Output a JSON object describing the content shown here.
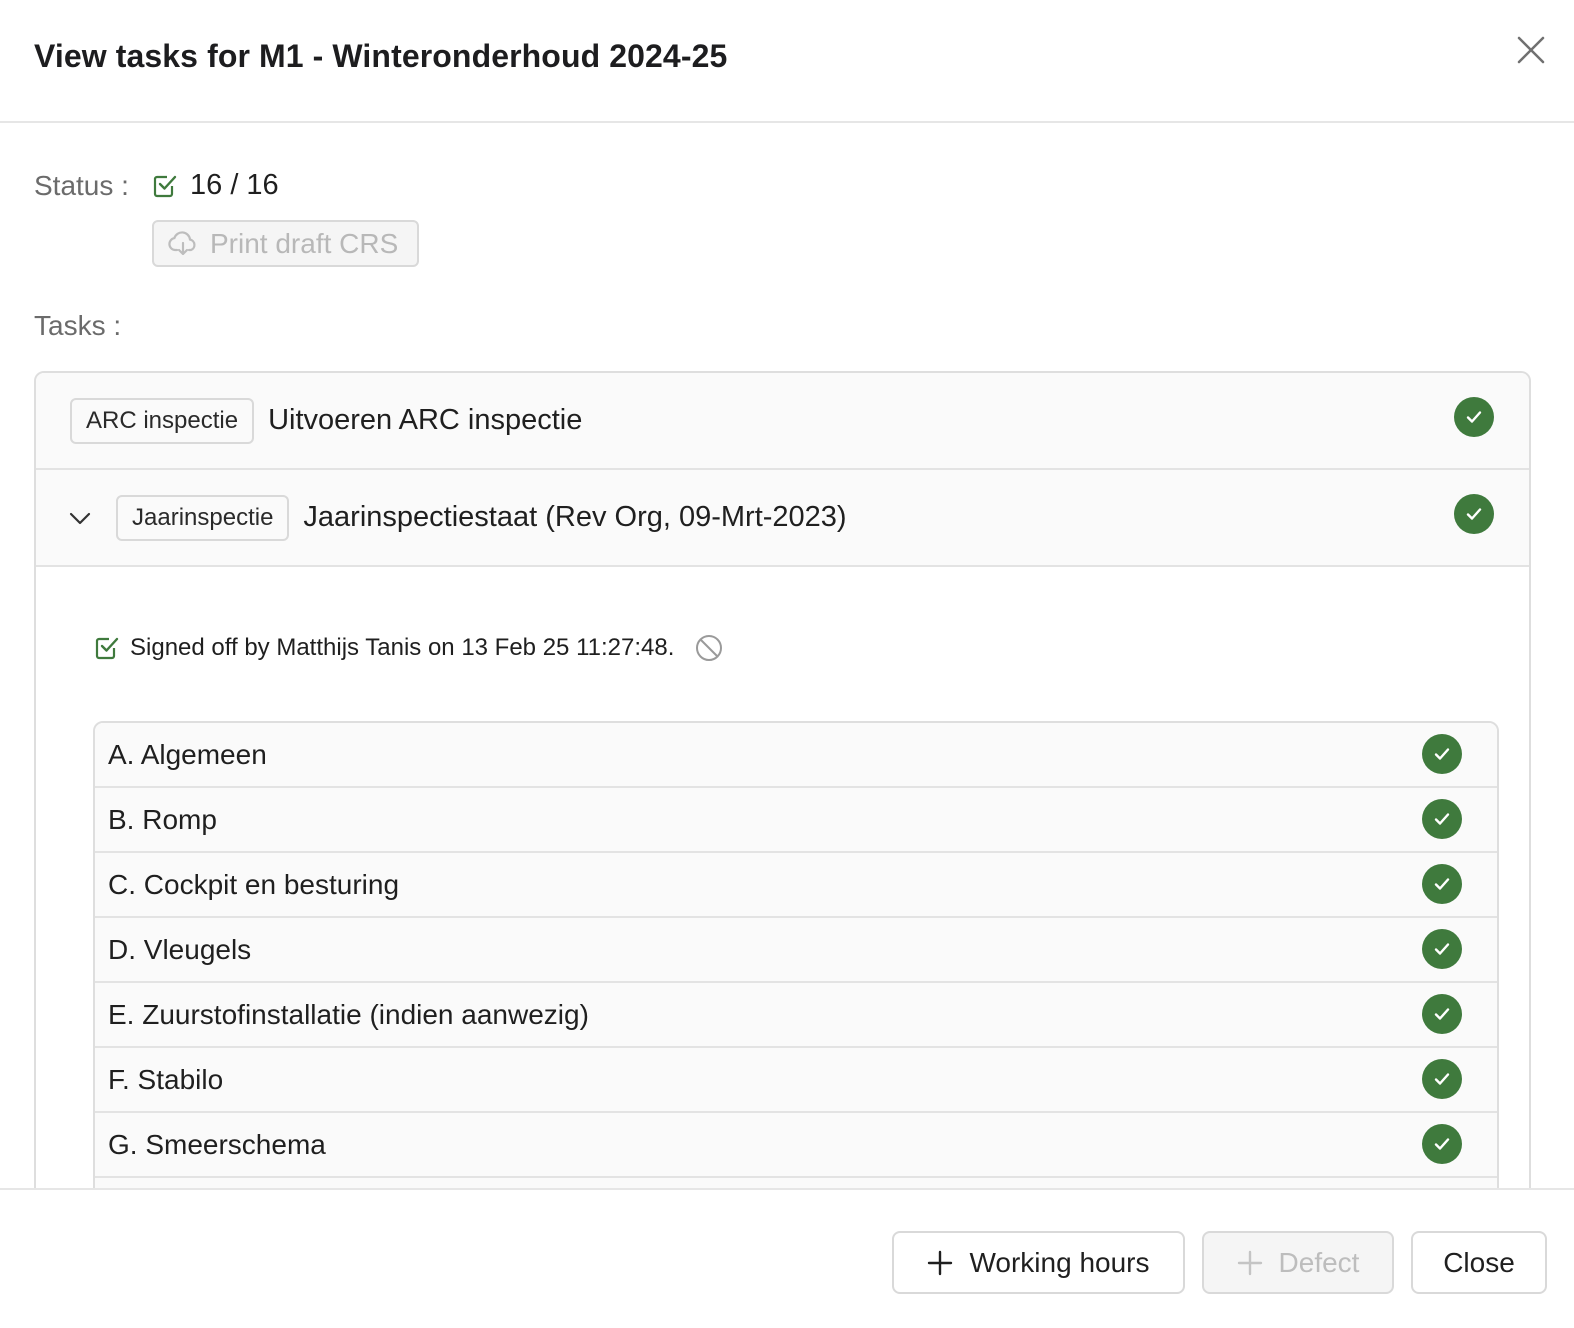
{
  "header": {
    "title": "View tasks for M1 - Winteronderhoud 2024-25",
    "close_icon": "close-icon"
  },
  "status": {
    "label": "Status :",
    "value": "16 / 16",
    "icon": "checkbox-checked-icon",
    "print_button_label": "Print draft CRS",
    "print_button_icon": "cloud-download-icon",
    "print_button_disabled": true
  },
  "tasks": {
    "label": "Tasks :",
    "items": [
      {
        "tag": "ARC inspectie",
        "name": "Uitvoeren ARC inspectie",
        "completed": true,
        "expanded": false
      },
      {
        "tag": "Jaarinspectie",
        "name": "Jaarinspectiestaat (Rev Org, 09-Mrt-2023)",
        "completed": true,
        "expanded": true,
        "signoff": "Signed off by Matthijs Tanis on 13 Feb 25 11:27:48.",
        "subitems": [
          {
            "label": "A. Algemeen",
            "completed": true
          },
          {
            "label": "B. Romp",
            "completed": true
          },
          {
            "label": "C. Cockpit en besturing",
            "completed": true
          },
          {
            "label": "D. Vleugels",
            "completed": true
          },
          {
            "label": "E. Zuurstofinstallatie (indien aanwezig)",
            "completed": true
          },
          {
            "label": "F. Stabilo",
            "completed": true
          },
          {
            "label": "G. Smeerschema",
            "completed": true
          }
        ]
      }
    ]
  },
  "footer": {
    "working_hours_label": "Working hours",
    "defect_label": "Defect",
    "defect_disabled": true,
    "close_label": "Close"
  },
  "colors": {
    "success": "#3f7a3d",
    "disabled_text": "#b8b8b8",
    "border": "#d9d9d9"
  }
}
